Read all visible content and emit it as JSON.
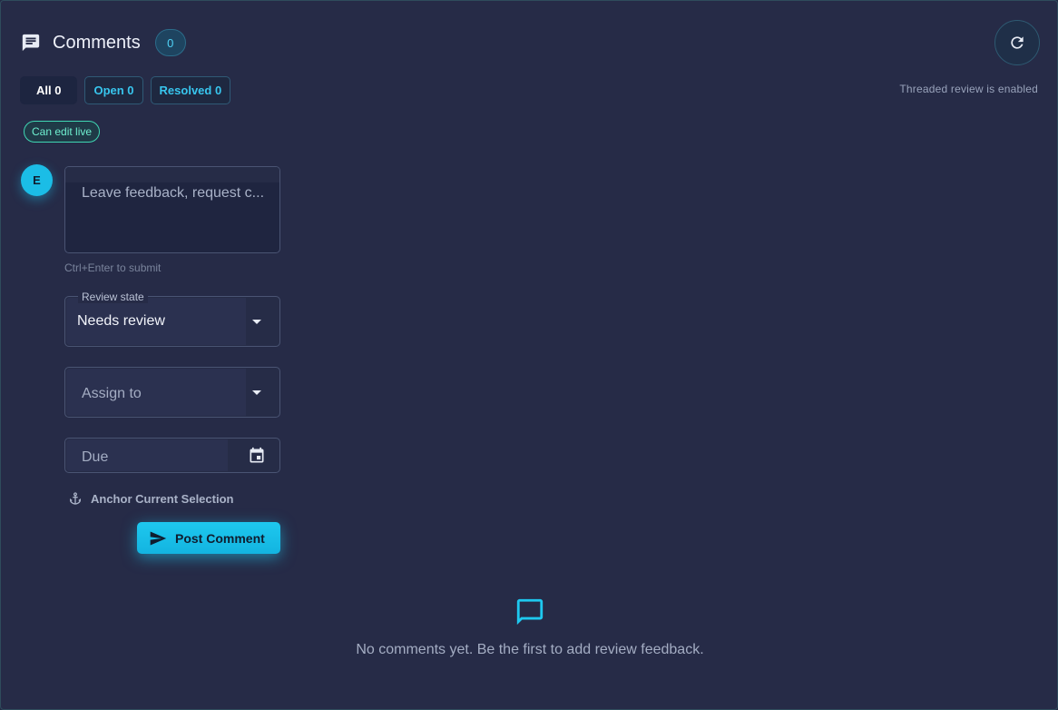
{
  "header": {
    "title": "Comments",
    "count": "0"
  },
  "filters": [
    {
      "label": "All 0"
    },
    {
      "label": "Open 0"
    },
    {
      "label": "Resolved 0"
    }
  ],
  "threaded_note": "Threaded review is enabled",
  "permission_badge": "Can edit live",
  "composer": {
    "avatar_initial": "E",
    "placeholder": "Leave feedback, request c...",
    "hint": "Ctrl+Enter to submit",
    "review_state": {
      "label": "Review state",
      "value": "Needs review"
    },
    "assign_to": {
      "placeholder": "Assign to"
    },
    "due": {
      "placeholder": "Due"
    },
    "anchor_label": "Anchor Current Selection",
    "post_label": "Post Comment"
  },
  "empty_state": {
    "text": "No comments yet. Be the first to add review feedback."
  },
  "colors": {
    "accent": "#1ec8ef",
    "background": "#262b47",
    "teal_badge": "#3fd6b3"
  }
}
